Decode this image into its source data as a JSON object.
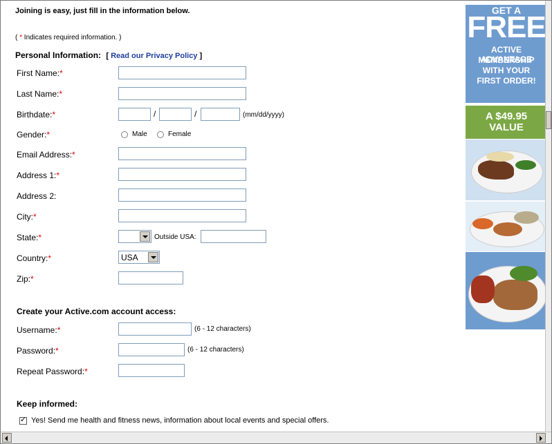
{
  "intro": "Joining is easy, just fill in the information below.",
  "required_note": {
    "open": "( ",
    "star": "*",
    "text": " Indicates required information. )"
  },
  "personal": {
    "heading": "Personal Information:",
    "privacy_open": "[ ",
    "privacy_link": "Read our Privacy Policy",
    "privacy_close": " ]"
  },
  "star": "*",
  "fields": {
    "first_name": "First Name:",
    "last_name": "Last Name:",
    "birthdate": "Birthdate:",
    "birthdate_sep": "/",
    "birthdate_hint": "(mm/dd/yyyy)",
    "gender": "Gender:",
    "gender_male": "Male",
    "gender_female": "Female",
    "email": "Email Address:",
    "address1": "Address 1:",
    "address2": "Address 2:",
    "city": "City:",
    "state": "State:",
    "outside_usa": "Outside USA:",
    "country": "Country:",
    "country_value": "USA",
    "zip": "Zip:"
  },
  "account": {
    "heading": "Create your Active.com account access:",
    "username": "Username:",
    "username_hint": "(6 - 12 characters)",
    "password": "Password:",
    "password_hint": "(6 - 12 characters)",
    "repeat_password": "Repeat Password:"
  },
  "keep_informed": {
    "heading": "Keep informed:",
    "checkbox_label": "Yes! Send me health and fitness news, information about local events and special offers.",
    "checked": true
  },
  "ad": {
    "get": "GET A",
    "free": "FREE",
    "line1": "ACTIVE ADVANTAGE",
    "line2": "MEMBERSHIP",
    "line3": "WITH YOUR",
    "line4": "FIRST ORDER!",
    "value1": "A $49.95",
    "value2": "VALUE",
    "colors": {
      "blue": "#6f9ccf",
      "green": "#7ba844"
    }
  }
}
